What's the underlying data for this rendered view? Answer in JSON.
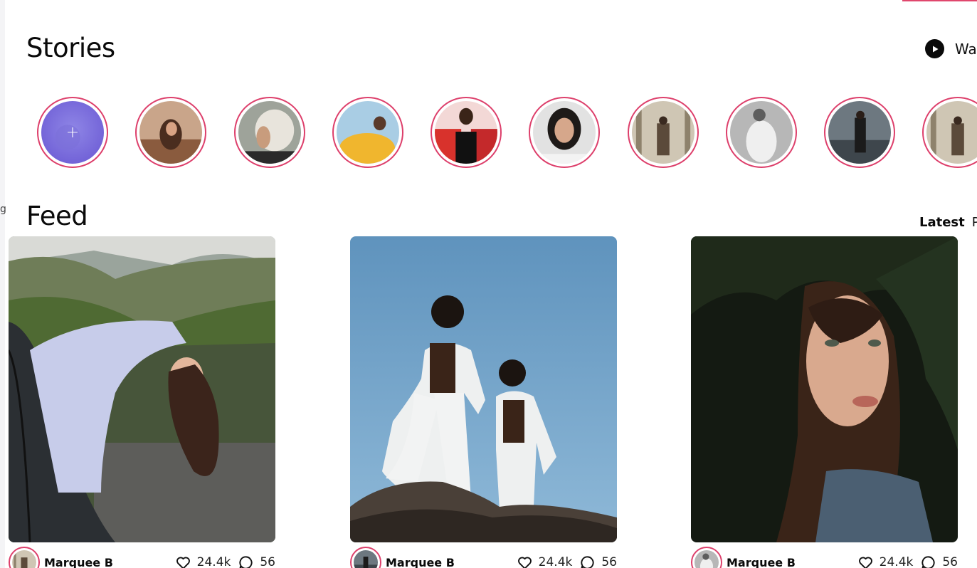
{
  "stories_section": {
    "title": "Stories",
    "watch_label": "Wa",
    "add_story_symbol": "+",
    "story_icons": [
      "add-story-icon",
      "story-avatar-1",
      "story-avatar-2",
      "story-avatar-3",
      "story-avatar-4",
      "story-avatar-5",
      "story-avatar-6",
      "story-avatar-7",
      "story-avatar-8",
      "story-avatar-9"
    ]
  },
  "feed_section": {
    "title": "Feed",
    "sort_tabs": [
      "Latest",
      "P"
    ]
  },
  "posts": [
    {
      "author": "Marquee B",
      "likes": "24.4k",
      "comments": "56"
    },
    {
      "author": "Marquee B",
      "likes": "24.4k",
      "comments": "56"
    },
    {
      "author": "Marquee B",
      "likes": "24.4k",
      "comments": "56"
    }
  ],
  "sidebar_glyph": "g",
  "colors": {
    "story_ring": "#dd3f6b",
    "accent": "#e0476d",
    "text": "#0a0a0a"
  }
}
